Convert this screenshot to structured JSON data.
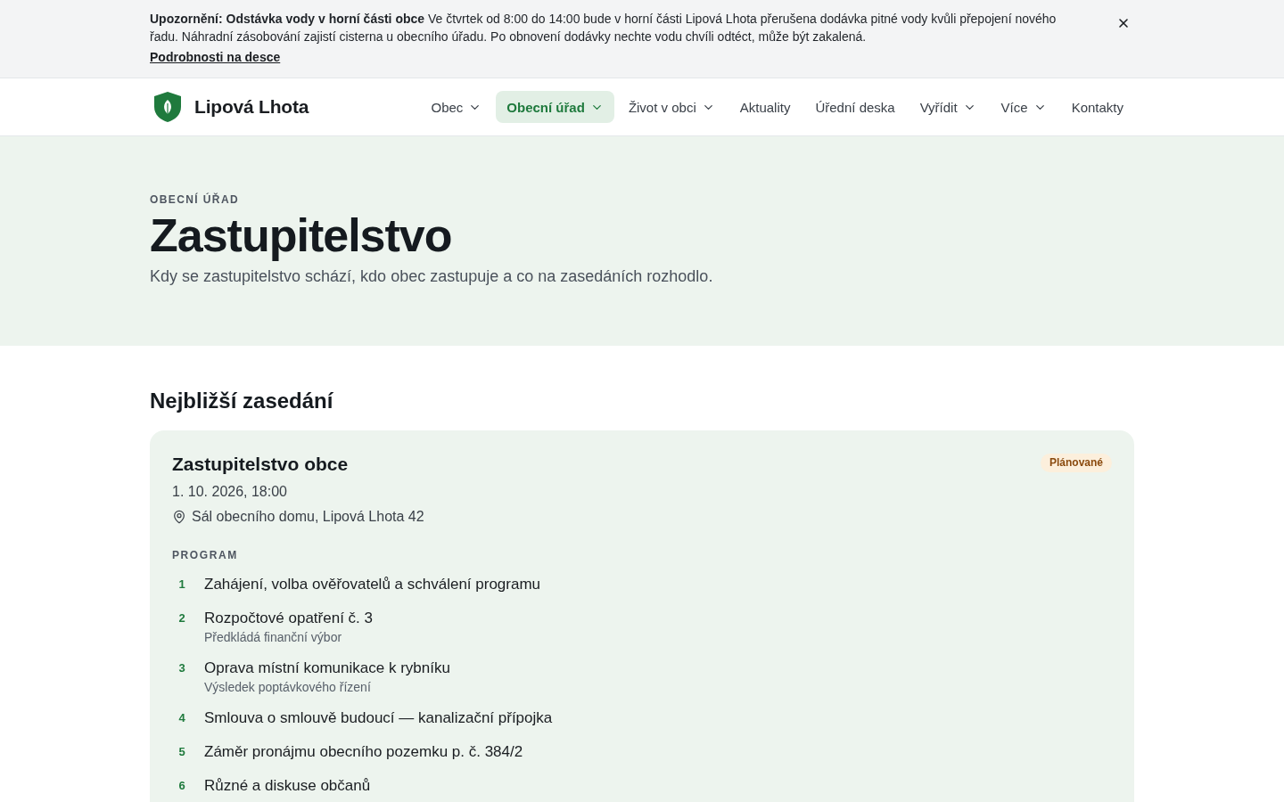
{
  "alert": {
    "message": "**Upozornění: Odstávka vody v horní části obce** Ve čtvrtek od 8:00 do 14:00 bude v horní části Lipová Lhota přerušena dodávka pitné vody kvůli přepojení nového řadu. Náhradní zásobování zajistí cisterna u obecního úřadu. Po obnovení dodávky nechte vodu chvíli odtéct, může být zakalená.",
    "link": "Podrobnosti na desce"
  },
  "header": {
    "site_name": "Lipová Lhota",
    "nav": [
      {
        "label": "Obec",
        "has_menu": true,
        "selected": false
      },
      {
        "label": "Obecní úřad",
        "has_menu": true,
        "selected": true
      },
      {
        "label": "Život v obci",
        "has_menu": true,
        "selected": false
      },
      {
        "label": "Aktuality",
        "has_menu": false,
        "selected": false
      },
      {
        "label": "Úřední deska",
        "has_menu": false,
        "selected": false
      },
      {
        "label": "Vyřídit",
        "has_menu": true,
        "selected": false
      },
      {
        "label": "Více",
        "has_menu": true,
        "selected": false
      },
      {
        "label": "Kontakty",
        "has_menu": false,
        "selected": false
      }
    ]
  },
  "hero": {
    "eyebrow": "OBECNÍ ÚŘAD",
    "title": "Zastupitelstvo",
    "subtitle": "Kdy se zastupitelstvo schází, kdo obec zastupuje a co na zasedáních rozhodlo."
  },
  "upcoming": {
    "heading": "Nejbližší zasedání",
    "meeting": {
      "title": "Zastupitelstvo obce",
      "status": {
        "label": "Plánované",
        "kind": "planned"
      },
      "datetime": "1. 10. 2026, 18:00",
      "location": "Sál obecního domu, Lipová Lhota 42",
      "program_label": "PROGRAM",
      "program": [
        {
          "number": "1",
          "title": "Zahájení, volba ověřovatelů a schválení programu"
        },
        {
          "number": "2",
          "title": "Rozpočtové opatření č. 3",
          "note": "Předkládá finanční výbor"
        },
        {
          "number": "3",
          "title": "Oprava místní komunikace k rybníku",
          "note": "Výsledek poptávkového řízení"
        },
        {
          "number": "4",
          "title": "Smlouva o smlouvě budoucí — kanalizační přípojka"
        },
        {
          "number": "5",
          "title": "Záměr pronájmu obecního pozemku p. č. 384/2"
        },
        {
          "number": "6",
          "title": "Různé a diskuse občanů"
        }
      ]
    }
  }
}
